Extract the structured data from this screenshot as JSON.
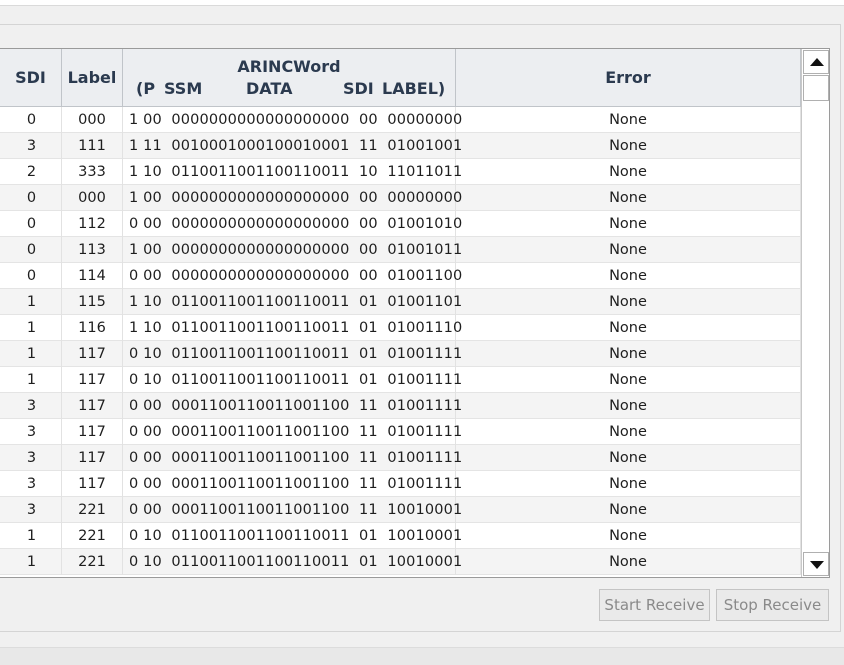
{
  "table": {
    "headers": {
      "sdi": "SDI",
      "label": "Label",
      "arinc_title": "ARINCWord",
      "arinc_sub": {
        "p": "(P",
        "ssm": "SSM",
        "data": "DATA",
        "sdi": "SDI",
        "label": "LABEL)"
      },
      "error": "Error"
    },
    "rows": [
      {
        "sdi": "0",
        "label": "000",
        "word": "1 00  0000000000000000000  00  00000000",
        "error": "None"
      },
      {
        "sdi": "3",
        "label": "111",
        "word": "1 11  0010001000100010001  11  01001001",
        "error": "None"
      },
      {
        "sdi": "2",
        "label": "333",
        "word": "1 10  0110011001100110011  10  11011011",
        "error": "None"
      },
      {
        "sdi": "0",
        "label": "000",
        "word": "1 00  0000000000000000000  00  00000000",
        "error": "None"
      },
      {
        "sdi": "0",
        "label": "112",
        "word": "0 00  0000000000000000000  00  01001010",
        "error": "None"
      },
      {
        "sdi": "0",
        "label": "113",
        "word": "1 00  0000000000000000000  00  01001011",
        "error": "None"
      },
      {
        "sdi": "0",
        "label": "114",
        "word": "0 00  0000000000000000000  00  01001100",
        "error": "None"
      },
      {
        "sdi": "1",
        "label": "115",
        "word": "1 10  0110011001100110011  01  01001101",
        "error": "None"
      },
      {
        "sdi": "1",
        "label": "116",
        "word": "1 10  0110011001100110011  01  01001110",
        "error": "None"
      },
      {
        "sdi": "1",
        "label": "117",
        "word": "0 10  0110011001100110011  01  01001111",
        "error": "None"
      },
      {
        "sdi": "1",
        "label": "117",
        "word": "0 10  0110011001100110011  01  01001111",
        "error": "None"
      },
      {
        "sdi": "3",
        "label": "117",
        "word": "0 00  0001100110011001100  11  01001111",
        "error": "None"
      },
      {
        "sdi": "3",
        "label": "117",
        "word": "0 00  0001100110011001100  11  01001111",
        "error": "None"
      },
      {
        "sdi": "3",
        "label": "117",
        "word": "0 00  0001100110011001100  11  01001111",
        "error": "None"
      },
      {
        "sdi": "3",
        "label": "117",
        "word": "0 00  0001100110011001100  11  01001111",
        "error": "None"
      },
      {
        "sdi": "3",
        "label": "221",
        "word": "0 00  0001100110011001100  11  10010001",
        "error": "None"
      },
      {
        "sdi": "1",
        "label": "221",
        "word": "0 10  0110011001100110011  01  10010001",
        "error": "None"
      },
      {
        "sdi": "1",
        "label": "221",
        "word": "0 10  0110011001100110011  01  10010001",
        "error": "None"
      }
    ]
  },
  "buttons": {
    "start_receive": "Start Receive",
    "stop_receive": "Stop Receive"
  },
  "colors": {
    "header_bg": "#eceef1",
    "header_text": "#2b3a4f",
    "alt_row": "#f4f4f4",
    "disabled_text": "#8a8a8a"
  }
}
